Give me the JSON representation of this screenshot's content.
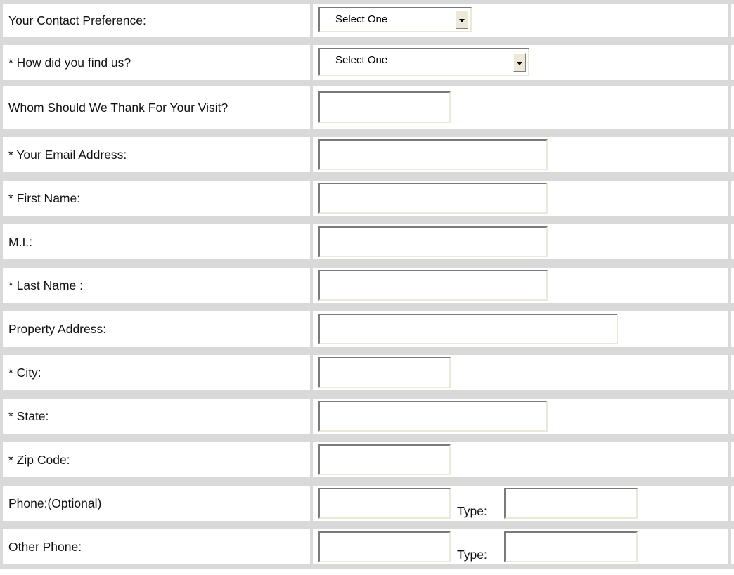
{
  "rows": {
    "contact_preference": {
      "label": "Your Contact Preference:",
      "value": "Select One"
    },
    "how_find": {
      "label": "* How did you find us?",
      "value": "Select One"
    },
    "thank": {
      "label": "Whom Should We Thank For Your Visit?",
      "value": ""
    },
    "email": {
      "label": "* Your Email Address:",
      "value": ""
    },
    "first_name": {
      "label": "* First Name:",
      "value": ""
    },
    "mi": {
      "label": "M.I.:",
      "value": ""
    },
    "last_name": {
      "label": "* Last Name :",
      "value": ""
    },
    "property_address": {
      "label": "Property Address:",
      "value": ""
    },
    "city": {
      "label": "* City:",
      "value": ""
    },
    "state": {
      "label": "* State:",
      "value": ""
    },
    "zip": {
      "label": "* Zip Code:",
      "value": ""
    },
    "phone": {
      "label": "Phone:(Optional)",
      "value": "",
      "type_label": "Type:",
      "type_value": ""
    },
    "other_phone": {
      "label": "Other Phone:",
      "value": "",
      "type_label": "Type:",
      "type_value": ""
    }
  },
  "icons": {
    "dropdown": "chevron-down-icon"
  },
  "colors": {
    "grid": "#d9d9d9",
    "field_border_dark": "#7a7a7a",
    "field_border_light": "#ece9d8"
  }
}
